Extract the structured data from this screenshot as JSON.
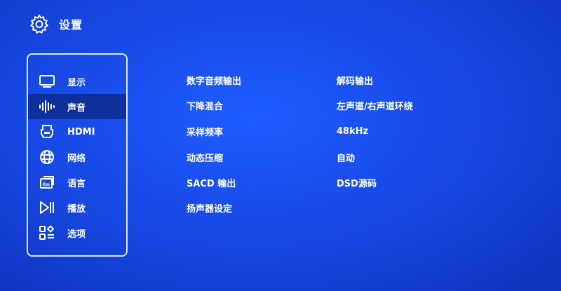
{
  "header": {
    "title": "设置",
    "icon": "gear-icon"
  },
  "sidebar": {
    "items": [
      {
        "label": "显示",
        "icon": "monitor-icon",
        "active": false
      },
      {
        "label": "声音",
        "icon": "sound-wave-icon",
        "active": true
      },
      {
        "label": "HDMI",
        "icon": "hdmi-icon",
        "active": false
      },
      {
        "label": "网络",
        "icon": "globe-icon",
        "active": false
      },
      {
        "label": "语言",
        "icon": "language-icon",
        "active": false
      },
      {
        "label": "播放",
        "icon": "play-pause-icon",
        "active": false
      },
      {
        "label": "选项",
        "icon": "options-grid-icon",
        "active": false
      }
    ]
  },
  "settings": {
    "rows": [
      {
        "name": "数字音频输出",
        "value": "解码输出"
      },
      {
        "name": "下降混合",
        "value": "左声道/右声道环绕"
      },
      {
        "name": "采样频率",
        "value": "48kHz"
      },
      {
        "name": "动态压缩",
        "value": "自动"
      },
      {
        "name": "SACD 输出",
        "value": "DSD源码"
      },
      {
        "name": "扬声器设定",
        "value": ""
      }
    ]
  },
  "colors": {
    "background": "#1646e0",
    "active_item": "#0f2f9c",
    "text": "#ffffff"
  }
}
